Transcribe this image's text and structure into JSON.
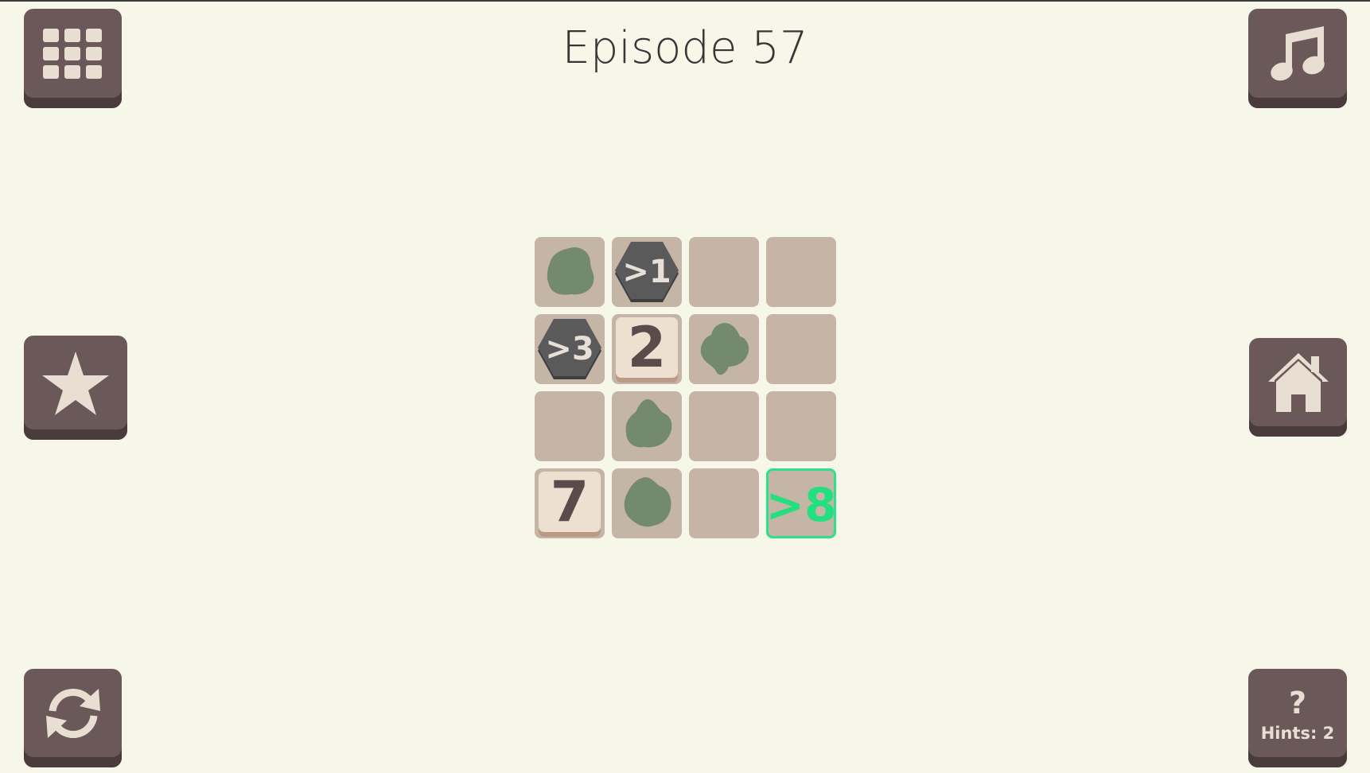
{
  "title": "Episode 57",
  "colors": {
    "background": "#f6f6e9",
    "button": "#6b5959",
    "tile": "#c5b5a7",
    "puddle": "#738a6e",
    "hex": "#5a5a5a",
    "target": "#2fe08a"
  },
  "buttons": {
    "levels": {
      "icon": "grid-icon"
    },
    "music": {
      "icon": "music-note-icon"
    },
    "star": {
      "icon": "star-icon"
    },
    "home": {
      "icon": "home-icon"
    },
    "restart": {
      "icon": "refresh-icon"
    },
    "hint": {
      "icon": "question-icon",
      "symbol": "?",
      "label": "Hints: 2"
    }
  },
  "board": {
    "rows": 4,
    "cols": 4,
    "cells": [
      [
        {
          "type": "puddle"
        },
        {
          "type": "hex",
          "text": ">1"
        },
        {
          "type": "empty"
        },
        {
          "type": "empty"
        }
      ],
      [
        {
          "type": "hex",
          "text": ">3"
        },
        {
          "type": "number",
          "text": "2"
        },
        {
          "type": "puddle"
        },
        {
          "type": "empty"
        }
      ],
      [
        {
          "type": "empty"
        },
        {
          "type": "puddle"
        },
        {
          "type": "empty"
        },
        {
          "type": "empty"
        }
      ],
      [
        {
          "type": "number",
          "text": "7"
        },
        {
          "type": "puddle"
        },
        {
          "type": "empty"
        },
        {
          "type": "target",
          "text": ">8"
        }
      ]
    ]
  }
}
